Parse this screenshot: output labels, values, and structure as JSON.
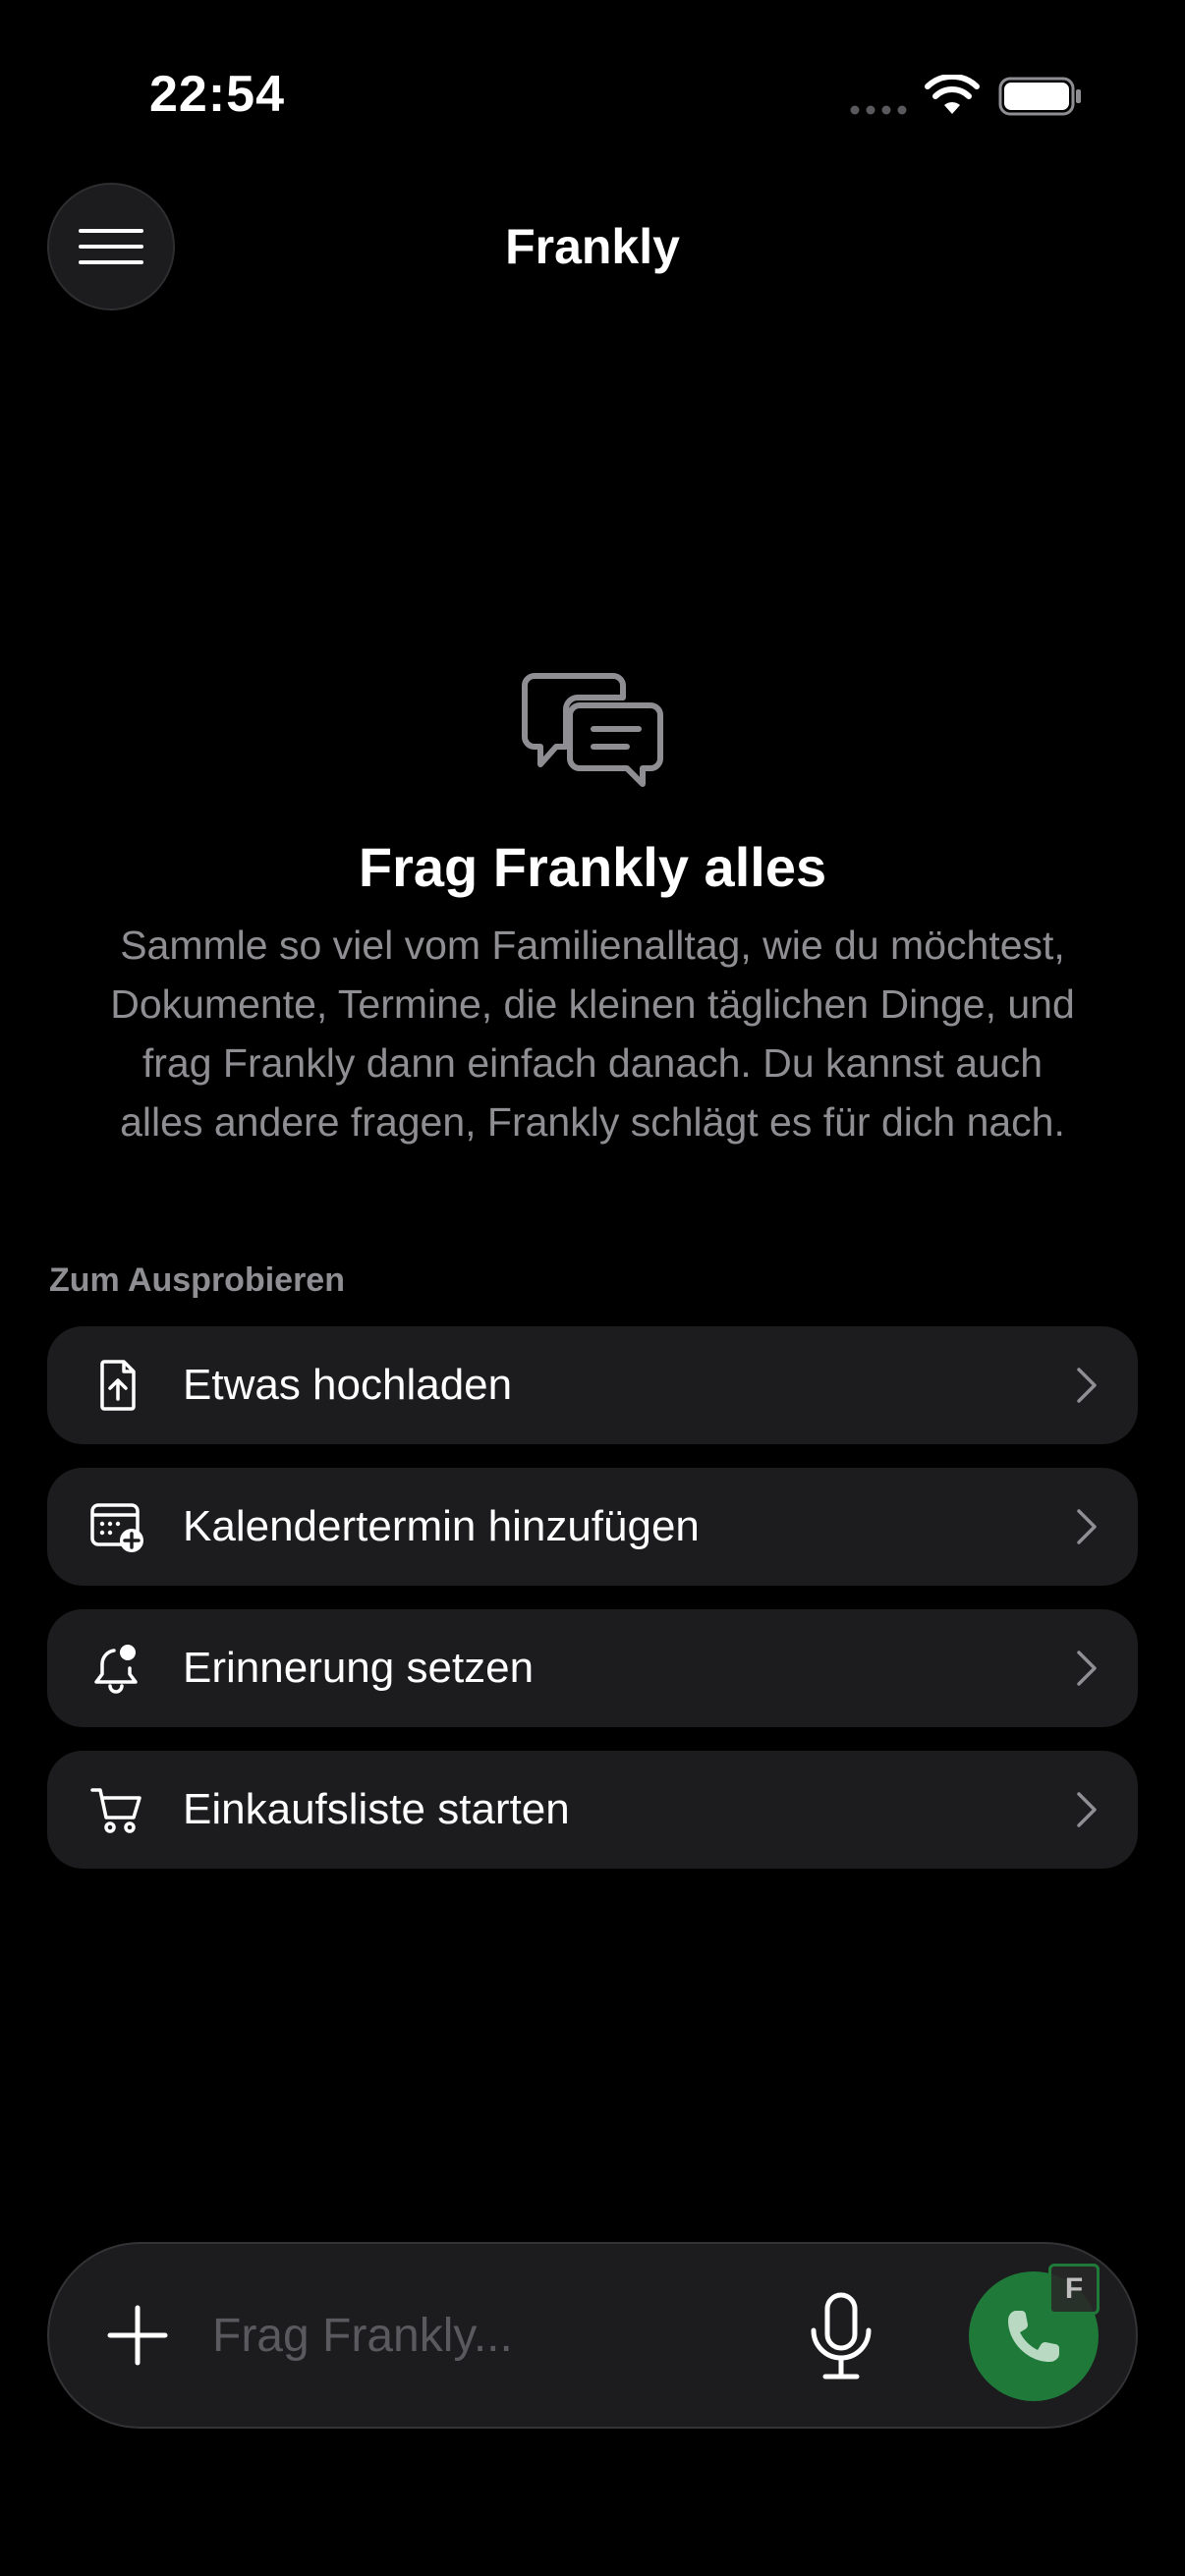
{
  "status_bar": {
    "time": "22:54",
    "wifi_icon": "wifi-icon",
    "battery_icon": "battery-icon"
  },
  "header": {
    "title": "Frankly",
    "menu_icon": "hamburger-menu-icon"
  },
  "empty_state": {
    "icon": "chat-bubbles-icon",
    "title": "Frag Frankly alles",
    "description": "Sammle so viel vom Familienalltag, wie du möchtest, Dokumente, Termine, die kleinen täglichen Dinge, und frag Frankly dann einfach danach. Du kannst auch alles andere fragen, Frankly schlägt es für dich nach."
  },
  "suggestions": {
    "section_label": "Zum Ausprobieren",
    "items": [
      {
        "label": "Etwas hochladen",
        "icon": "document-upload-icon"
      },
      {
        "label": "Kalendertermin hinzufügen",
        "icon": "calendar-add-icon"
      },
      {
        "label": "Erinnerung setzen",
        "icon": "bell-icon"
      },
      {
        "label": "Einkaufsliste starten",
        "icon": "cart-icon"
      }
    ]
  },
  "input_bar": {
    "placeholder": "Frag Frankly...",
    "value": "",
    "badge_letter": "F"
  },
  "colors": {
    "background": "#000000",
    "card": "#1c1c1e",
    "secondary_text": "#8e8e93",
    "call_green": "#1f7a3a"
  }
}
